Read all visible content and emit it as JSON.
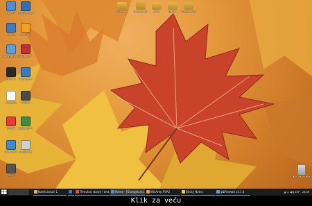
{
  "desktop_icons": [
    {
      "label": "Ovaj PC",
      "icon": "computer-icon",
      "color": "#4a8fd8"
    },
    {
      "label": "TeamViewer",
      "icon": "app-icon",
      "color": "#2f6fb8"
    },
    {
      "label": "Mreža",
      "icon": "network-icon",
      "color": "#3c7cc4"
    },
    {
      "label": "WinAmp",
      "icon": "player-icon",
      "color": "#f4a020"
    },
    {
      "label": "Upravljačka ploča",
      "icon": "control-panel-icon",
      "color": "#5aa0e0"
    },
    {
      "label": "CCleaner",
      "icon": "cleaner-icon",
      "color": "#c03030"
    },
    {
      "label": "Recuva",
      "icon": "recovery-icon",
      "color": "#2a2a2a"
    },
    {
      "label": "Defraggler",
      "icon": "defrag-icon",
      "color": "#3a78c8"
    },
    {
      "label": "Inkscape",
      "icon": "vector-icon",
      "color": "#ffffff"
    },
    {
      "label": "Monitor",
      "icon": "monitor-icon",
      "color": "#4a4a4a"
    },
    {
      "label": "Vivaldi",
      "icon": "browser-icon",
      "color": "#e83a3a"
    },
    {
      "label": "Notepad++",
      "icon": "editor-icon",
      "color": "#3d8f3d"
    },
    {
      "label": "Pale Moon",
      "icon": "globe-icon",
      "color": "#3a8ad8"
    },
    {
      "label": "Sandboxie",
      "icon": "sandbox-icon",
      "color": "#d0d0d0"
    },
    {
      "label": "GIMP",
      "icon": "image-editor-icon",
      "color": "#555555"
    }
  ],
  "top_icons": [
    {
      "label": "Ovisnosti",
      "icon": "folder-icon",
      "color": "#e6b84a"
    },
    {
      "label": "Dokumenti",
      "icon": "folder-icon",
      "color": "#d8a840"
    },
    {
      "label": "Slike",
      "icon": "folder-icon",
      "color": "#e6b84a"
    },
    {
      "label": "Glazba",
      "icon": "folder-icon",
      "color": "#e6b84a"
    },
    {
      "label": "Preuzimanja",
      "icon": "folder-icon",
      "color": "#dbb050"
    }
  ],
  "recycle_bin": {
    "label": "Koš za smeće",
    "icon": "recycle-bin-icon"
  },
  "taskbar": {
    "tasks": [
      {
        "label": "Kolekcionari 1",
        "color": "#e6b84a",
        "active": false
      },
      {
        "label": "",
        "color": "#3c7cc4",
        "active": false
      },
      {
        "label": "Trenutno stanje i test...",
        "color": "#e05a20",
        "active": false
      },
      {
        "label": "Home - [Orangeland...",
        "color": "#4a90d8",
        "active": true
      },
      {
        "label": "WinAmp PVA2",
        "color": "#f4a020",
        "active": false
      },
      {
        "label": "Sticky Notes",
        "color": "#e6d04a",
        "active": false
      },
      {
        "label": "glbfirewall v3.1.4",
        "color": "#5aa0e0",
        "active": false
      }
    ],
    "tray_lang": "SRP",
    "clock": "23:09"
  },
  "caption": "Klik za veću"
}
